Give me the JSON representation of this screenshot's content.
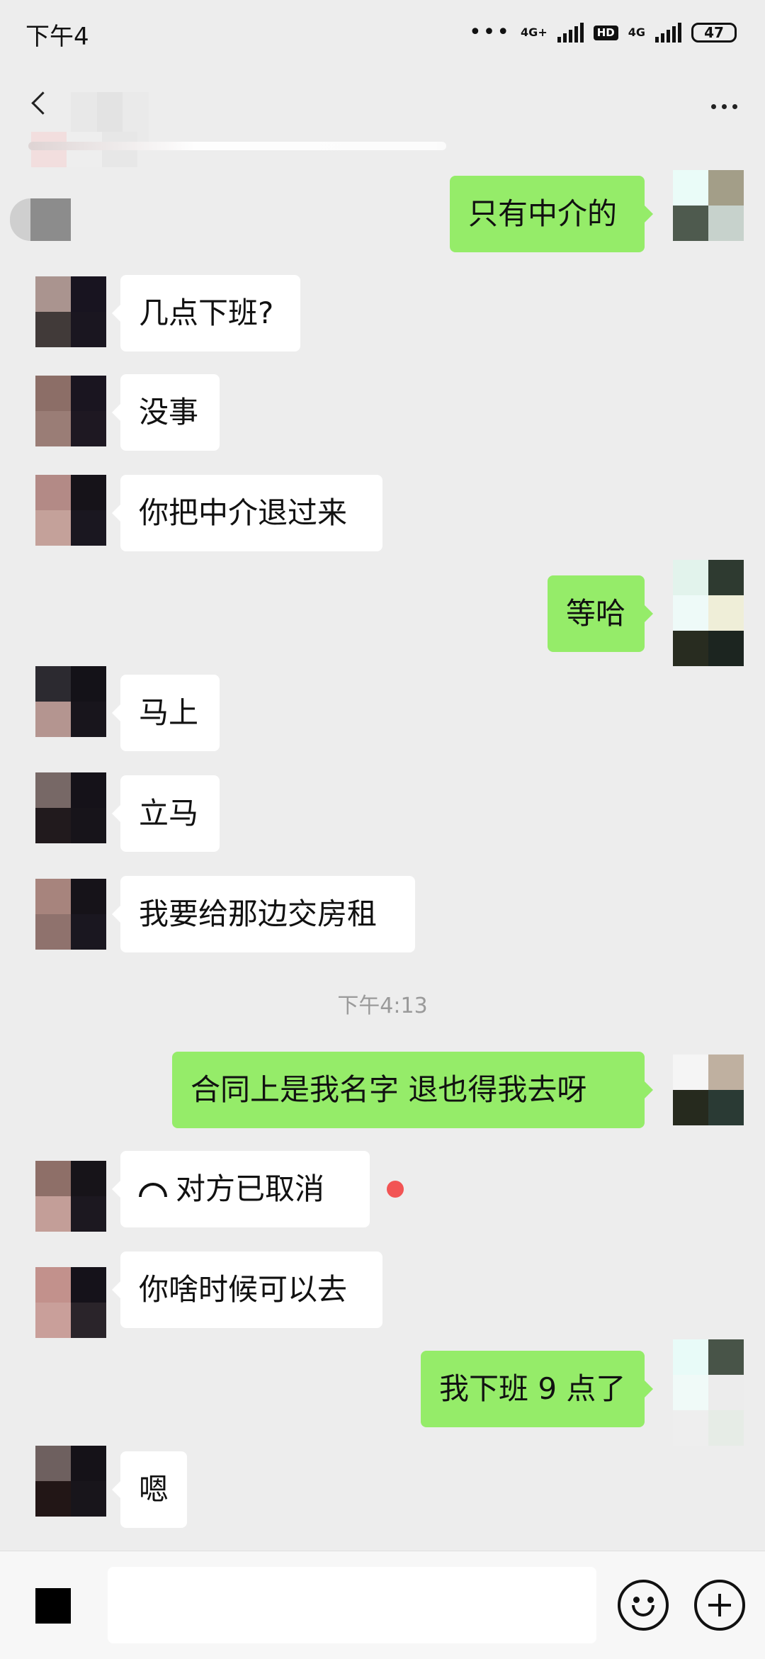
{
  "status_bar": {
    "time": "下午4",
    "network_1": "4G+",
    "network_2": "4G",
    "hd": "HD",
    "battery": "47"
  },
  "header": {
    "back_icon": "back-chevron-icon",
    "more_icon": "more-dots-icon"
  },
  "messages": [
    {
      "side": "out",
      "text": "只有中介的"
    },
    {
      "side": "in",
      "text": "几点下班?"
    },
    {
      "side": "in",
      "text": "没事"
    },
    {
      "side": "in",
      "text": "你把中介退过来"
    },
    {
      "side": "out",
      "text": "等哈"
    },
    {
      "side": "in",
      "text": "马上"
    },
    {
      "side": "in",
      "text": "立马"
    },
    {
      "side": "in",
      "text": "我要给那边交房租"
    },
    {
      "type": "timestamp",
      "text": "下午4:13"
    },
    {
      "side": "out",
      "text": "合同上是我名字  退也得我去呀"
    },
    {
      "side": "in",
      "text": "对方已取消",
      "icon": "phone-hangup-icon",
      "unread": true
    },
    {
      "side": "in",
      "text": "你啥时候可以去"
    },
    {
      "side": "out",
      "text": "我下班 9 点了"
    },
    {
      "side": "in",
      "text": "嗯"
    }
  ],
  "input_bar": {
    "placeholder": "",
    "voice_icon": "voice-icon",
    "emoji_icon": "emoji-icon",
    "plus_icon": "plus-icon"
  },
  "colors": {
    "background": "#ededed",
    "outgoing_bubble": "#95ec69",
    "incoming_bubble": "#ffffff",
    "unread_dot": "#f25454"
  }
}
